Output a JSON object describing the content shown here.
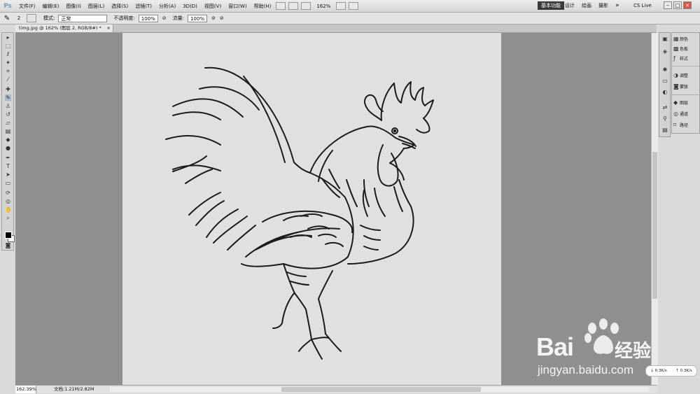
{
  "app": {
    "logo": "Ps"
  },
  "menu": [
    "文件(F)",
    "编辑(E)",
    "图像(I)",
    "图层(L)",
    "选择(S)",
    "滤镜(T)",
    "分析(A)",
    "3D(D)",
    "视图(V)",
    "窗口(W)",
    "帮助(H)"
  ],
  "appbar": {
    "zoom": "162%"
  },
  "workspaces": {
    "active": "基本功能",
    "items": [
      "设计",
      "绘画",
      "摄影"
    ],
    "more": "»",
    "cslive": "CS Live"
  },
  "options": {
    "brush_size": "2",
    "mode_label": "模式:",
    "mode_value": "正常",
    "opacity_label": "不透明度:",
    "opacity_value": "100%",
    "flow_label": "流量:",
    "flow_value": "100%"
  },
  "document": {
    "tab_title": "timg.jpg @ 162% (图层 2, RGB/8#) *",
    "tab_close": "×"
  },
  "status": {
    "zoom": "162.39%",
    "doc_info": "文档:1.21M/2.82M"
  },
  "panels": {
    "items": [
      "颜色",
      "色板",
      "样式",
      "调整",
      "蒙版",
      "图层",
      "通道",
      "路径"
    ]
  },
  "watermark": {
    "brand": "Bai",
    "brand2": "经验",
    "url": "jingyan.baidu.com"
  },
  "net": {
    "down": "0.3K/s",
    "up": "0.3K/s"
  },
  "icons": {
    "tools": [
      "move-icon",
      "marquee-icon",
      "lasso-icon",
      "quick-select-icon",
      "crop-icon",
      "eyedropper-icon",
      "healing-icon",
      "brush-icon",
      "clone-stamp-icon",
      "history-brush-icon",
      "eraser-icon",
      "gradient-icon",
      "blur-icon",
      "dodge-icon",
      "pen-icon",
      "type-icon",
      "path-select-icon",
      "shape-icon",
      "3d-rotate-icon",
      "3d-orbit-icon",
      "hand-icon",
      "zoom-icon"
    ],
    "dock": [
      "color-panel-icon",
      "swatches-panel-icon",
      "adjust-panel-icon",
      "masks-panel-icon",
      "layers-panel-icon",
      "channels-panel-icon",
      "paths-panel-icon",
      "brush-panel-icon"
    ]
  }
}
